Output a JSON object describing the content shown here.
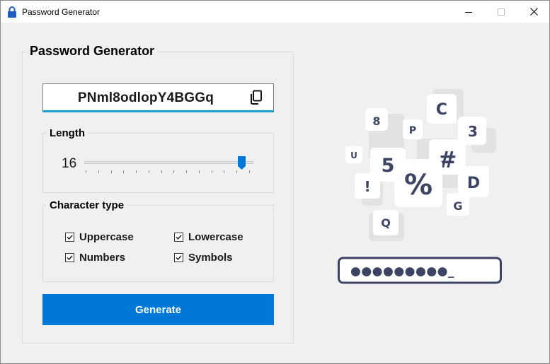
{
  "window": {
    "title": "Password Generator",
    "controls": {
      "minimize": "minimize",
      "maximize": "maximize",
      "close": "close"
    }
  },
  "main": {
    "group_title": "Password Generator",
    "password": "PNml8odlopY4BGGq",
    "length": {
      "group_title": "Length",
      "value": "16",
      "slider_fraction": 0.93,
      "tick_count": 14
    },
    "character_type": {
      "group_title": "Character type",
      "options": [
        {
          "label": "Uppercase",
          "checked": true
        },
        {
          "label": "Lowercase",
          "checked": true
        },
        {
          "label": "Numbers",
          "checked": true
        },
        {
          "label": "Symbols",
          "checked": true
        }
      ]
    },
    "generate_label": "Generate"
  },
  "illustration": {
    "glyphs": [
      "8",
      "C",
      "P",
      "3",
      "U",
      "5",
      "#",
      "%",
      "!",
      "D",
      "G",
      "Q"
    ],
    "masked_password": "●●●●●●●●●_",
    "ink_color": "#3d4463"
  },
  "colors": {
    "accent": "#0078d7",
    "underline": "#1e9fd2",
    "background": "#f0f0f0"
  }
}
